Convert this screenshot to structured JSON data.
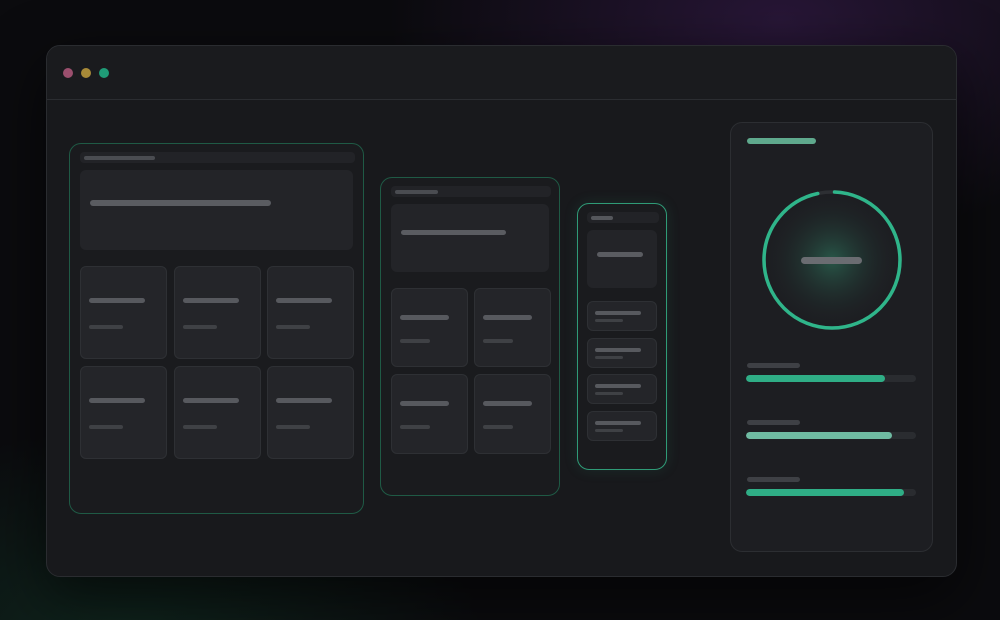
{
  "window": {
    "controls": [
      "close-dot",
      "minimize-dot",
      "maximize-dot"
    ],
    "colors": {
      "close": "#9b4f6e",
      "minimize": "#a88a38",
      "maximize": "#1f9c77"
    }
  },
  "accent": "#2fb58a",
  "metrics": {
    "gauge_value": 0.96,
    "bars": [
      {
        "value": 0.82,
        "color": "#2fae86"
      },
      {
        "value": 0.86,
        "color": "#6fbba2"
      },
      {
        "value": 0.93,
        "color": "#2fae86"
      }
    ]
  }
}
